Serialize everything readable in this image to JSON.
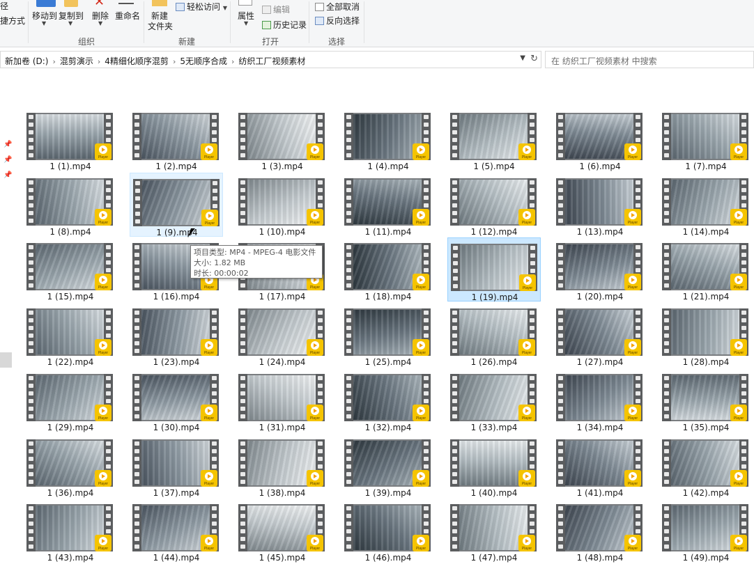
{
  "ribbon": {
    "left_cut_top": "径",
    "left_cut_bottom": "捷方式",
    "move_to": "移动到",
    "copy_to": "复制到",
    "delete": "删除",
    "rename": "重命名",
    "new_folder_line1": "新建",
    "new_folder_line2": "文件夹",
    "easy_access": "轻松访问",
    "properties": "属性",
    "edit": "编辑",
    "history": "历史记录",
    "select_none": "全部取消",
    "invert_selection": "反向选择",
    "group_organize": "组织",
    "group_new": "新建",
    "group_open": "打开",
    "group_select": "选择"
  },
  "breadcrumb": [
    "新加卷 (D:)",
    "混剪演示",
    "4精细化顺序混剪",
    "5无顺序合成",
    "纺织工厂视频素材"
  ],
  "search": {
    "placeholder": "在 纺织工厂视频素材 中搜索"
  },
  "badge_text": "Player",
  "files": [
    "1 (1).mp4",
    "1 (2).mp4",
    "1 (3).mp4",
    "1 (4).mp4",
    "1 (5).mp4",
    "1 (6).mp4",
    "1 (7).mp4",
    "1 (8).mp4",
    "1 (9).mp4",
    "1 (10).mp4",
    "1 (11).mp4",
    "1 (12).mp4",
    "1 (13).mp4",
    "1 (14).mp4",
    "1 (15).mp4",
    "1 (16).mp4",
    "1 (17).mp4",
    "1 (18).mp4",
    "1 (19).mp4",
    "1 (20).mp4",
    "1 (21).mp4",
    "1 (22).mp4",
    "1 (23).mp4",
    "1 (24).mp4",
    "1 (25).mp4",
    "1 (26).mp4",
    "1 (27).mp4",
    "1 (28).mp4",
    "1 (29).mp4",
    "1 (30).mp4",
    "1 (31).mp4",
    "1 (32).mp4",
    "1 (33).mp4",
    "1 (34).mp4",
    "1 (35).mp4",
    "1 (36).mp4",
    "1 (37).mp4",
    "1 (38).mp4",
    "1 (39).mp4",
    "1 (40).mp4",
    "1 (41).mp4",
    "1 (42).mp4",
    "1 (43).mp4",
    "1 (44).mp4",
    "1 (45).mp4",
    "1 (46).mp4",
    "1 (47).mp4",
    "1 (48).mp4",
    "1 (49).mp4"
  ],
  "selected_file": "1 (19).mp4",
  "hovered_file": "1 (9).mp4",
  "tooltip": {
    "type": "项目类型: MP4 - MPEG-4 电影文件",
    "size": "大小: 1.82 MB",
    "duration": "时长: 00:00:02"
  },
  "colors": {
    "badge": "#f5c400",
    "selection": "#cce8ff",
    "film_strip": "#5b5d5f"
  }
}
